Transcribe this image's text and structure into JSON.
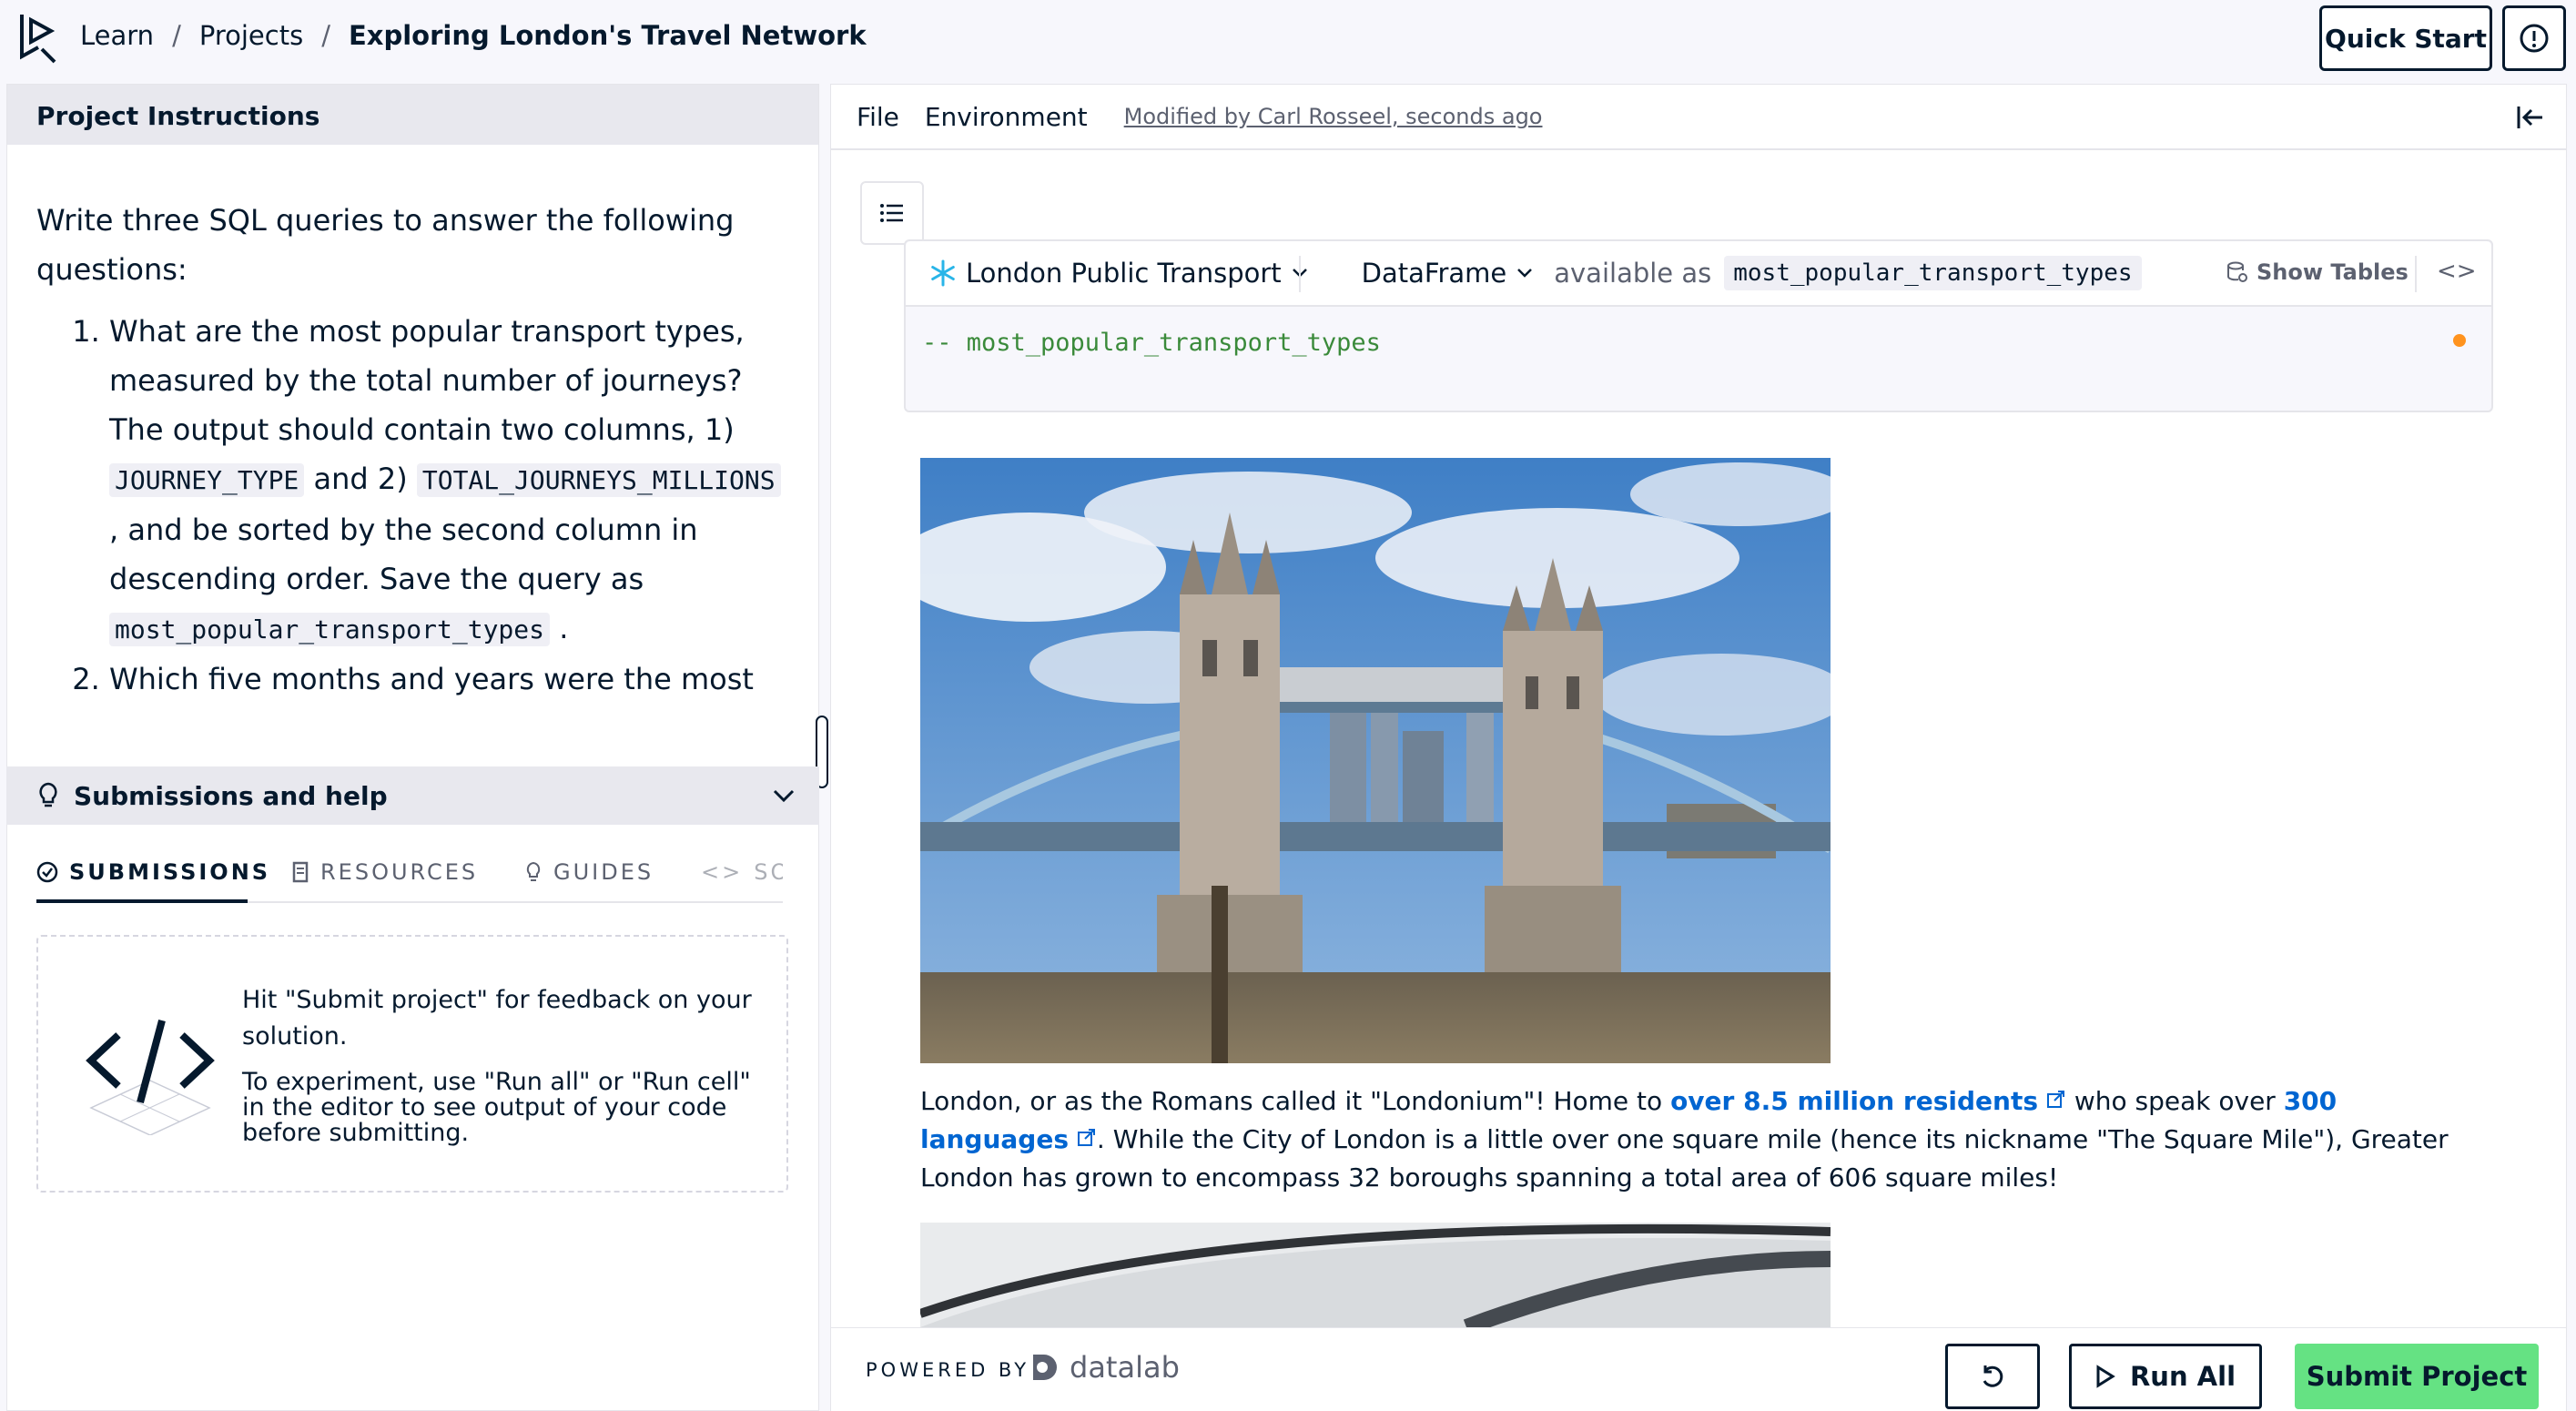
{
  "breadcrumb": {
    "learn": "Learn",
    "projects": "Projects",
    "current": "Exploring London's Travel Network",
    "separator": "/"
  },
  "header": {
    "quick_start": "Quick Start"
  },
  "instructions": {
    "title": "Project Instructions",
    "intro": "Write three SQL queries to answer the following questions:",
    "q1_text_a": "What are the most popular transport types, measured by the total number of journeys? The output should contain two columns, 1)",
    "q1_code_a": "JOURNEY_TYPE",
    "q1_text_b": "and 2)",
    "q1_code_b": "TOTAL_JOURNEYS_MILLIONS",
    "q1_text_c": ", and be sorted by the second column in descending order. Save the query as",
    "q1_code_c": "most_popular_transport_types",
    "q1_text_d": ".",
    "q2_text": "Which five months and years were the most"
  },
  "submissions": {
    "title": "Submissions and help",
    "tabs": [
      "SUBMISSIONS",
      "RESOURCES",
      "GUIDES",
      "SOLUTION"
    ],
    "hint1": "Hit \"Submit project\" for feedback on your solution.",
    "hint2": "To experiment, use \"Run all\" or \"Run cell\" in the editor to see output of your code before submitting."
  },
  "editor": {
    "menu_file": "File",
    "menu_env": "Environment",
    "modified": "Modified by Carl Rosseel, seconds ago",
    "cell": {
      "source": "London Public Transport",
      "output_type": "DataFrame",
      "available_as": "available as",
      "var_name": "most_popular_transport_types",
      "show_tables": "Show Tables",
      "sql": "-- most_popular_transport_types"
    },
    "paragraph": {
      "a": "London, or as the Romans called it \"Londonium\"! Home to ",
      "link1": "over 8.5 million residents",
      "b": " who speak over ",
      "link2": "300 languages",
      "c": ". While the City of London is a little over one square mile (hence its nickname \"The Square Mile\"), Greater London has grown to encompass 32 boroughs spanning a total area of 606 square miles!"
    }
  },
  "footer": {
    "powered_by": "POWERED BY",
    "brand": "datalab",
    "run_all": "Run All",
    "submit": "Submit Project"
  },
  "colors": {
    "accent_green": "#65e283",
    "link_blue": "#0065d1",
    "navy": "#05192d"
  }
}
